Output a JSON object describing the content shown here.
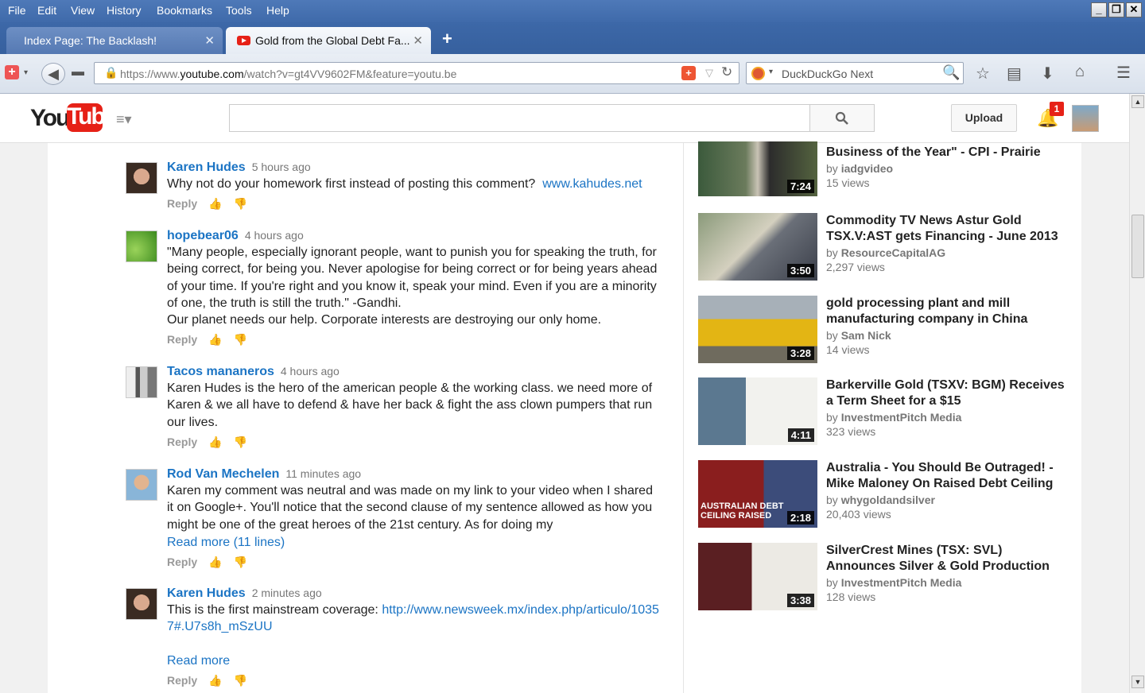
{
  "menu": {
    "items": [
      "File",
      "Edit",
      "View",
      "History",
      "Bookmarks",
      "Tools",
      "Help"
    ]
  },
  "window": {
    "min": "_",
    "max": "❐",
    "close": "✕"
  },
  "tabs": [
    {
      "title": "Index Page: The Backlash!",
      "close": "✕"
    },
    {
      "title": "Gold from the Global Debt Fa...",
      "close": "✕"
    }
  ],
  "newtab": "+",
  "nav": {
    "url_prefix": "https://www.",
    "url_domain": "youtube.com",
    "url_path": "/watch?v=gt4VV9602FM&feature=youtu.be",
    "search_engine": "DuckDuckGo Next"
  },
  "youtube": {
    "logo_you": "You",
    "logo_tube": "Tube",
    "guide": "≡▾",
    "upload": "Upload",
    "notifications": "1"
  },
  "comments": [
    {
      "author": "Karen Hudes",
      "time": "5 hours ago",
      "text": "Why not do your homework first instead of posting this comment?",
      "link": "www.kahudes.net",
      "reply": "Reply"
    },
    {
      "author": "hopebear06",
      "time": "4 hours ago",
      "text": "\"Many people, especially ignorant people, want to punish you for speaking the truth, for being correct, for being you. Never apologise for being correct or for being years ahead of your time. If you're right and you know it, speak your mind. Even if you are a minority of one, the truth is still the truth.\" -Gandhi.",
      "text2": "Our planet needs our help. Corporate interests are destroying our only home.",
      "reply": "Reply"
    },
    {
      "author": "Tacos mananeros",
      "time": "4 hours ago",
      "text": "Karen Hudes is the hero of the american people & the working class. we need more of Karen & we all have to defend & have her back & fight the ass clown pumpers that run our lives.",
      "reply": "Reply"
    },
    {
      "author": "Rod Van Mechelen",
      "time": "11 minutes ago",
      "text": "Karen my comment was neutral and was made on my link to your video when I shared it on Google+. You'll notice that the second clause of my sentence allowed as how you might be one of the great heroes of the 21st century. As for doing my",
      "more": "Read more (11 lines)",
      "reply": "Reply"
    },
    {
      "author": "Karen Hudes",
      "time": "2 minutes ago",
      "text": "This is the first mainstream coverage:",
      "link": "http://www.newsweek.mx/index.php/articulo/10357#.U7s8h_mSzUU",
      "more": "Read more",
      "reply": "Reply"
    }
  ],
  "related": [
    {
      "title": "Business of the Year\" - CPI - Prairie",
      "by": "by",
      "channel": "iadgvideo",
      "views": "15 views",
      "duration": "7:24"
    },
    {
      "title": "Commodity TV News Astur Gold TSX.V:AST gets Financing - June 2013",
      "by": "by",
      "channel": "ResourceCapitalAG",
      "views": "2,297 views",
      "duration": "3:50"
    },
    {
      "title": "gold processing plant and mill manufacturing company in China",
      "by": "by",
      "channel": "Sam Nick",
      "views": "14 views",
      "duration": "3:28"
    },
    {
      "title": "Barkerville Gold (TSXV: BGM) Receives a Term Sheet for a $15",
      "by": "by",
      "channel": "InvestmentPitch Media",
      "views": "323 views",
      "duration": "4:11"
    },
    {
      "title": "Australia - You Should Be Outraged! - Mike Maloney On Raised Debt Ceiling",
      "by": "by",
      "channel": "whygoldandsilver",
      "views": "20,403 views",
      "duration": "2:18",
      "overlay": "AUSTRALIAN DEBT CEILING RAISED"
    },
    {
      "title": "SilverCrest Mines (TSX: SVL) Announces Silver & Gold Production",
      "by": "by",
      "channel": "InvestmentPitch Media",
      "views": "128 views",
      "duration": "3:38"
    }
  ]
}
